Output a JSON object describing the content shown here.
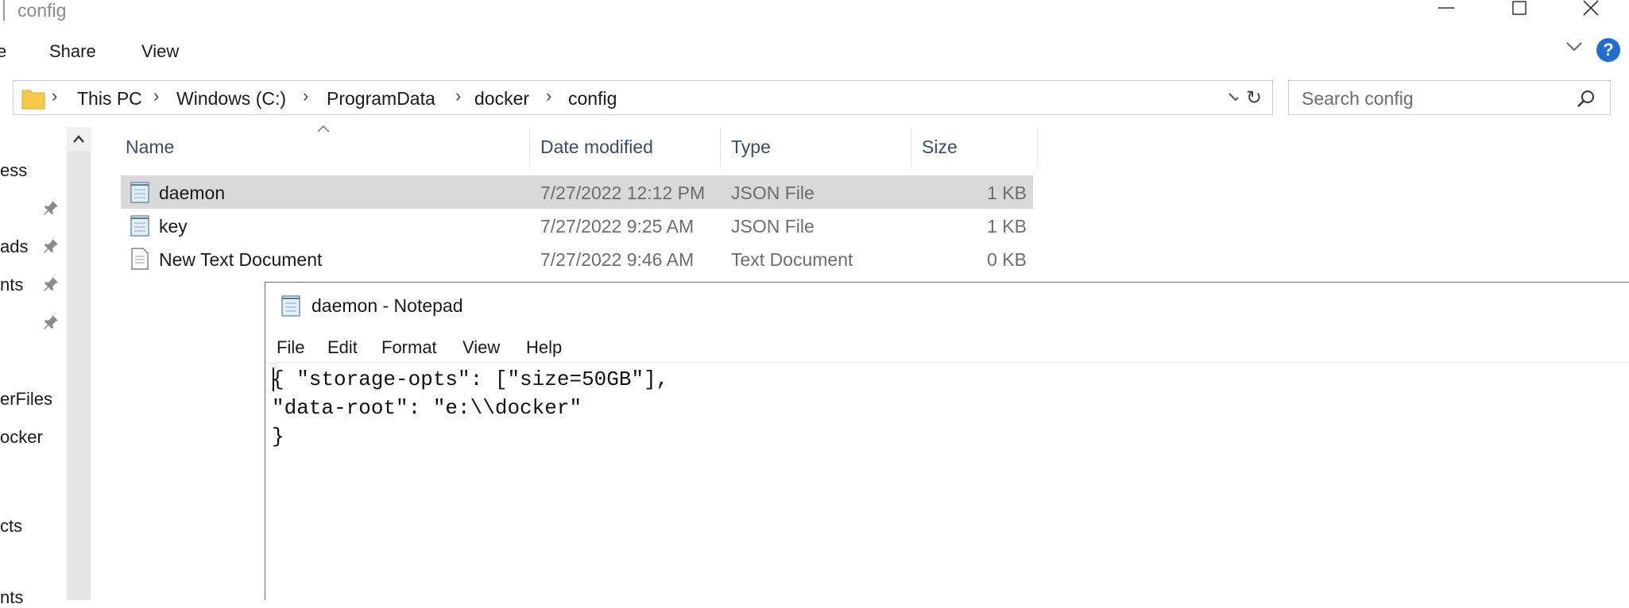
{
  "explorer": {
    "title": "config",
    "ribbon_tabs": [
      "e",
      "Share",
      "View"
    ],
    "help_label": "?",
    "address": {
      "crumbs": [
        "This PC",
        "Windows (C:)",
        "ProgramData",
        "docker",
        "config"
      ]
    },
    "search": {
      "placeholder": "Search config"
    },
    "nav": {
      "items": [
        "ess",
        "ads",
        "nts",
        "erFiles",
        "ocker",
        "cts",
        "nts"
      ]
    },
    "columns": [
      "Name",
      "Date modified",
      "Type",
      "Size"
    ],
    "files": [
      {
        "name": "daemon",
        "date": "7/27/2022 12:12 PM",
        "type": "JSON File",
        "size": "1 KB",
        "selected": true
      },
      {
        "name": "key",
        "date": "7/27/2022 9:25 AM",
        "type": "JSON File",
        "size": "1 KB",
        "selected": false
      },
      {
        "name": "New Text Document",
        "date": "7/27/2022 9:46 AM",
        "type": "Text Document",
        "size": "0 KB",
        "selected": false
      }
    ]
  },
  "notepad": {
    "title": "daemon - Notepad",
    "menu": [
      "File",
      "Edit",
      "Format",
      "View",
      "Help"
    ],
    "content": "{ \"storage-opts\": [\"size=50GB\"],\n\"data-root\": \"e:\\\\docker\"\n}"
  },
  "colors": {
    "selected_row": "#d9d9d9",
    "help_blue": "#1f6fce",
    "header_text": "#3a4d6b"
  }
}
